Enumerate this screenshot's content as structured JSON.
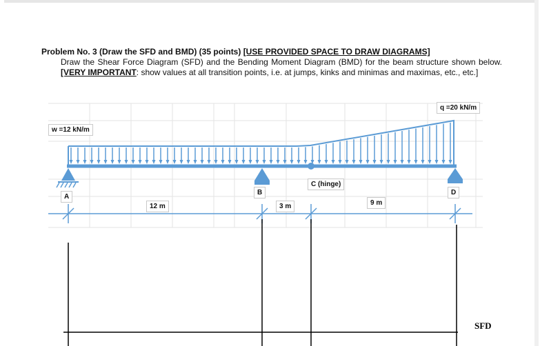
{
  "problem": {
    "title_main": "Problem No. 3  (Draw the SFD and BMD) (35 points) ",
    "title_bracket": "[USE PROVIDED SPACE TO DRAW DIAGRAMS]",
    "body_intro": "Draw the Shear Force Diagram (SFD) and the Bending Moment Diagram (BMD) for the beam structure shown below. ",
    "important_label": "[VERY IMPORTANT",
    "body_rest": ": show values at all transition points, i.e. at jumps, kinks and minimas and maximas, etc., etc.]"
  },
  "figure": {
    "load_left": "w =12 kN/m",
    "load_right": "q =20 kN/m",
    "support_a": "A",
    "support_b": "B",
    "hinge_c": "C (hinge)",
    "support_d": "D",
    "span_ab": "12 m",
    "span_bc": "3 m",
    "span_cd": "9 m",
    "beam_color": "#5b9bd5"
  },
  "diagram_label": "SFD"
}
